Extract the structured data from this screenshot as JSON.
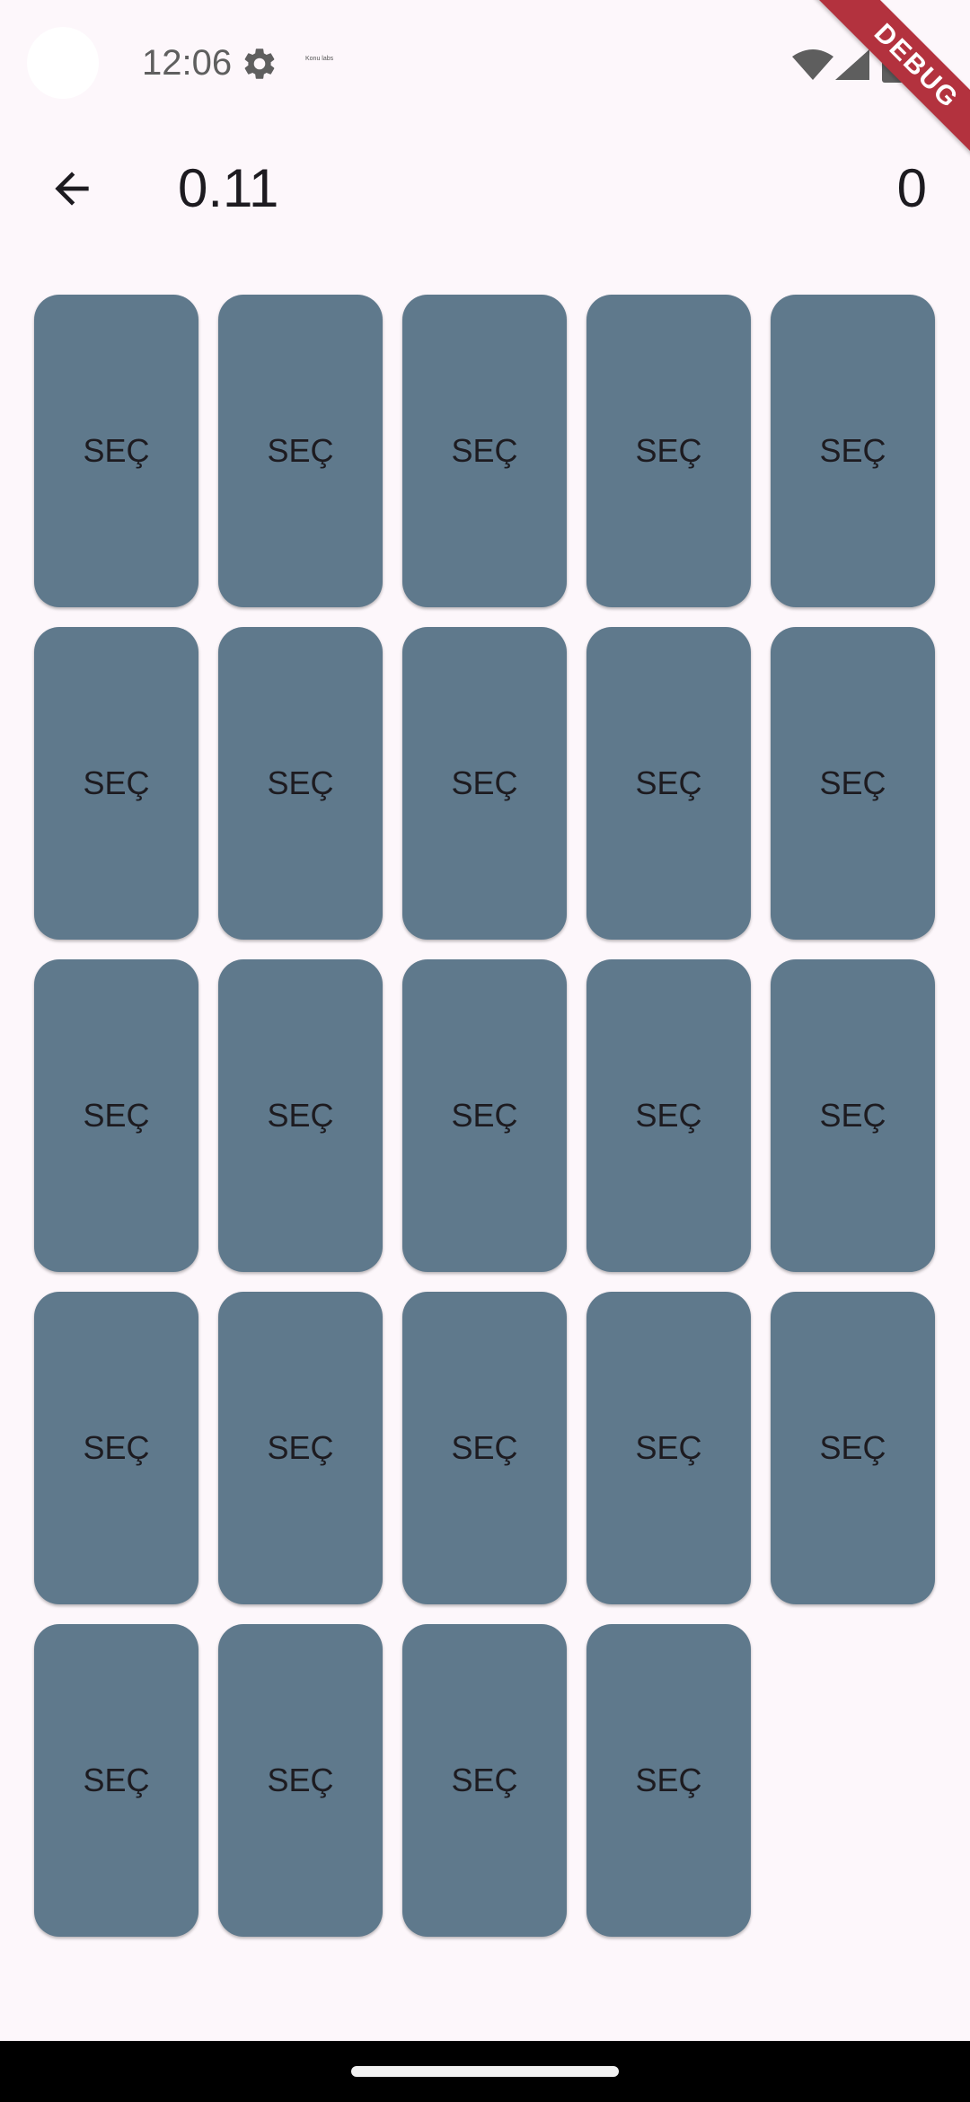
{
  "status_bar": {
    "time": "12:06",
    "notification_text": "Konu\nlabs",
    "icons": [
      "gear-icon",
      "wifi-icon",
      "signal-icon",
      "battery-icon"
    ]
  },
  "debug_banner": "DEBUG",
  "app_bar": {
    "back_icon": "arrow-left-icon",
    "title": "0.11",
    "score": "0"
  },
  "cards": [
    {
      "label": "SEÇ"
    },
    {
      "label": "SEÇ"
    },
    {
      "label": "SEÇ"
    },
    {
      "label": "SEÇ"
    },
    {
      "label": "SEÇ"
    },
    {
      "label": "SEÇ"
    },
    {
      "label": "SEÇ"
    },
    {
      "label": "SEÇ"
    },
    {
      "label": "SEÇ"
    },
    {
      "label": "SEÇ"
    },
    {
      "label": "SEÇ"
    },
    {
      "label": "SEÇ"
    },
    {
      "label": "SEÇ"
    },
    {
      "label": "SEÇ"
    },
    {
      "label": "SEÇ"
    },
    {
      "label": "SEÇ"
    },
    {
      "label": "SEÇ"
    },
    {
      "label": "SEÇ"
    },
    {
      "label": "SEÇ"
    },
    {
      "label": "SEÇ"
    },
    {
      "label": "SEÇ"
    },
    {
      "label": "SEÇ"
    },
    {
      "label": "SEÇ"
    },
    {
      "label": "SEÇ"
    }
  ],
  "colors": {
    "background": "#fdf7fb",
    "card": "#5f798c",
    "debug_ribbon": "#b3323e"
  }
}
